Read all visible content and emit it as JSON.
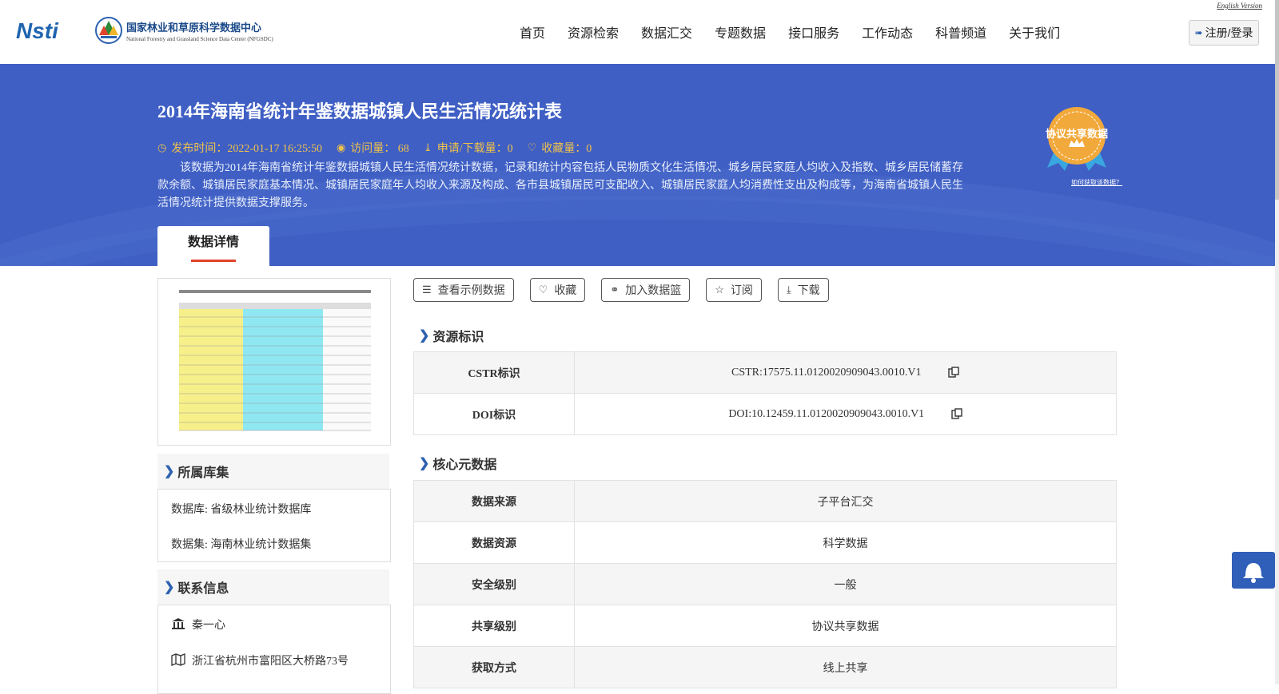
{
  "header": {
    "english_link": "English Version",
    "logo_nsti": "Nsti",
    "center_name": "国家林业和草原科学数据中心",
    "center_name_en": "National Forestry and Grassland Science Data Center (NFGSDC)",
    "nav": [
      "首页",
      "资源检索",
      "数据汇交",
      "专题数据",
      "接口服务",
      "工作动态",
      "科普频道",
      "关于我们"
    ],
    "login_label": "注册/登录"
  },
  "banner": {
    "title": "2014年海南省统计年鉴数据城镇人民生活情况统计表",
    "publish_time": "发布时间：2022-01-17 16:25:50",
    "visits": "访问量： 68",
    "downloads": "申请/下载量：0",
    "favorites": "收藏量：0",
    "description": "该数据为2014年海南省统计年鉴数据城镇人民生活情况统计数据，记录和统计内容包括人民物质文化生活情况、城乡居民家庭人均收入及指数、城乡居民储蓄存款余额、城镇居民家庭基本情况、城镇居民家庭年人均收入来源及构成、各市县城镇居民可支配收入、城镇居民家庭人均消费性支出及构成等，为海南省城镇人民生活情况统计提供数据支撑服务。",
    "badge_text": "协议共享数据",
    "badge_link": "如何获取该数据？",
    "tab_label": "数据详情"
  },
  "sidebar": {
    "library_title": "所属库集",
    "database": "数据库: 省级林业统计数据库",
    "dataset": "数据集: 海南林业统计数据集",
    "contact_title": "联系信息",
    "contact_name": "秦一心",
    "contact_address": "浙江省杭州市富阳区大桥路73号"
  },
  "actions": [
    "查看示例数据",
    "收藏",
    "加入数据篮",
    "订阅",
    "下载"
  ],
  "resource_id": {
    "title": "资源标识",
    "rows": [
      {
        "key": "CSTR标识",
        "value": "CSTR:17575.11.0120020909043.0010.V1"
      },
      {
        "key": "DOI标识",
        "value": "DOI:10.12459.11.0120020909043.0010.V1"
      }
    ]
  },
  "core_metadata": {
    "title": "核心元数据",
    "rows": [
      {
        "key": "数据来源",
        "value": "子平台汇交"
      },
      {
        "key": "数据资源",
        "value": "科学数据"
      },
      {
        "key": "安全级别",
        "value": "一般"
      },
      {
        "key": "共享级别",
        "value": "协议共享数据"
      },
      {
        "key": "获取方式",
        "value": "线上共享"
      }
    ]
  },
  "colors": {
    "banner_bg": "#3f5fc4",
    "meta_yellow": "#f1c24a",
    "accent_blue": "#2d62b0",
    "tab_underline": "#e2422b"
  }
}
